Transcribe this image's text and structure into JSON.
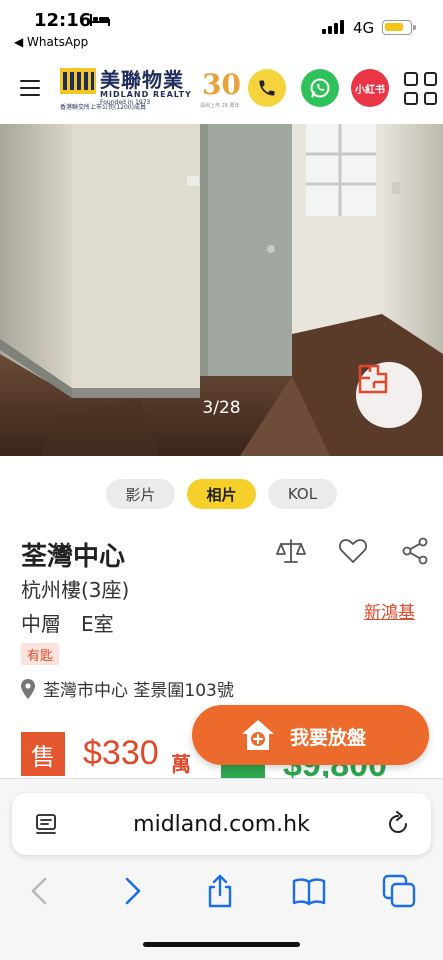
{
  "status_bar": {
    "time": "12:16",
    "back_app": "◀ WhatsApp",
    "network": "4G"
  },
  "header": {
    "brand_cn": "美聯物業",
    "brand_en": "MIDLAND REALTY",
    "founded": "Founded in 1973",
    "tagline": "香港聯交所上市公司(1200)成員",
    "anniversary_number": "30",
    "anniversary_sub": "深圳上市 28 周年",
    "xiaohongshu_label": "小紅书"
  },
  "gallery": {
    "counter": "3/28"
  },
  "media_tabs": [
    {
      "label": "影片",
      "active": false
    },
    {
      "label": "相片",
      "active": true
    },
    {
      "label": "KOL",
      "active": false
    }
  ],
  "listing": {
    "estate": "荃灣中心",
    "block": "杭州樓(3座)",
    "floor_unit": "中層　E室",
    "developer": "新鴻基",
    "key_badge": "有匙",
    "address": "荃灣市中心 荃景圍103號"
  },
  "price": {
    "sale_badge": "售",
    "sale_price": "$330",
    "sale_unit": "萬",
    "rent_price": "$9,800"
  },
  "list_button": {
    "label": "我要放盤"
  },
  "browser": {
    "url": "midland.com.hk"
  },
  "colors": {
    "accent_orange": "#ec6a2c",
    "price_red": "#e0492a",
    "tab_yellow": "#f5d02a",
    "whatsapp_green": "#2fc15a"
  }
}
